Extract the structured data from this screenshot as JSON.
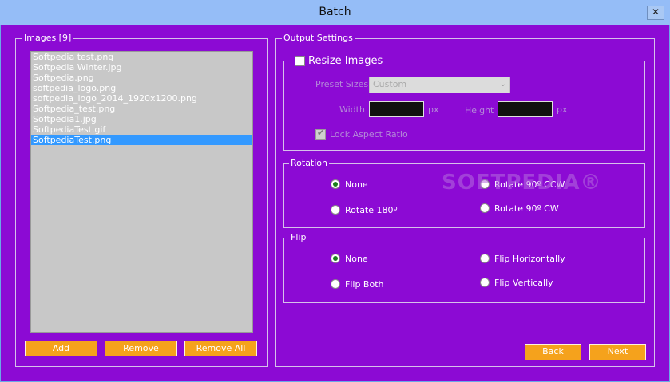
{
  "window": {
    "title": "Batch",
    "close_glyph": "✕"
  },
  "images": {
    "legend": "Images [9]",
    "items": [
      "Softpedia test.png",
      "Softpedia Winter.jpg",
      "Softpedia.png",
      "softpedia_logo.png",
      "softpedia_logo_2014_1920x1200.png",
      "Softpedia_test.png",
      "Softpedia1.jpg",
      "SoftpediaTest.gif",
      "SoftpediaTest.png"
    ],
    "selected_index": 8,
    "buttons": {
      "add": "Add",
      "remove": "Remove",
      "remove_all": "Remove All"
    }
  },
  "output": {
    "legend": "Output Settings",
    "resize": {
      "label": "Resize Images",
      "checked": false,
      "preset_label": "Preset Sizes",
      "preset_value": "Custom",
      "width_label": "Width",
      "width_value": "",
      "width_unit": "px",
      "height_label": "Height",
      "height_value": "",
      "height_unit": "px",
      "lock_label": "Lock Aspect Ratio",
      "lock_checked": true
    },
    "rotation": {
      "legend": "Rotation",
      "options": [
        "None",
        "Rotate 90º CCW",
        "Rotate 180º",
        "Rotate 90º CW"
      ],
      "selected": "None"
    },
    "flip": {
      "legend": "Flip",
      "options": [
        "None",
        "Flip Horizontally",
        "Flip Both",
        "Flip Vertically"
      ],
      "selected": "None"
    }
  },
  "nav": {
    "back": "Back",
    "next": "Next"
  },
  "watermark": "SOFTPEDIA®",
  "colors": {
    "background": "#8c0ad4",
    "button": "#f5a21c",
    "selection": "#3399ff",
    "titlebar": "#95bdf7"
  }
}
